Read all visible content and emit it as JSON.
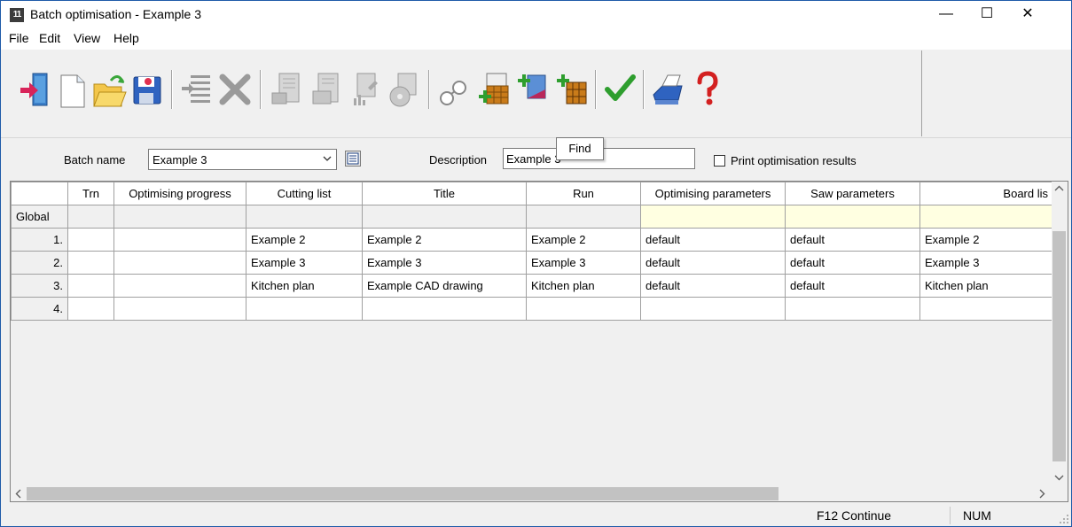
{
  "window": {
    "title": "Batch optimisation - Example 3",
    "app_icon": "11",
    "minimize": "—",
    "maximize": "☐",
    "close": "✕"
  },
  "menu": [
    "File",
    "Edit",
    "View",
    "Help"
  ],
  "toolbar": {
    "tooltip": "Find",
    "buttons": [
      "exit-icon",
      "new-icon",
      "open-icon",
      "save-icon",
      "indent-icon",
      "delete-icon",
      "preview-icon",
      "report-icon",
      "chart-report-icon",
      "saw-report-icon",
      "find-icon",
      "add-list-icon",
      "add-colour-icon",
      "add-board-icon",
      "check-icon",
      "print-icon",
      "help-icon"
    ]
  },
  "fields": {
    "batch_name_label": "Batch name",
    "batch_name_value": "Example 3",
    "description_label": "Description",
    "description_value": "Example 3",
    "print_results_label": "Print optimisation results",
    "print_results_checked": false
  },
  "grid": {
    "columns": [
      "",
      "Trn",
      "Optimising progress",
      "Cutting list",
      "Title",
      "Run",
      "Optimising parameters",
      "Saw parameters",
      "Board lis"
    ],
    "global_label": "Global",
    "rows": [
      {
        "num": "1.",
        "trn": "",
        "progress": "",
        "cutting_list": "Example 2",
        "title": "Example 2",
        "run": "Example 2",
        "opt_params": "default",
        "saw_params": "default",
        "board_list": "Example 2"
      },
      {
        "num": "2.",
        "trn": "",
        "progress": "",
        "cutting_list": "Example 3",
        "title": "Example 3",
        "run": "Example 3",
        "opt_params": "default",
        "saw_params": "default",
        "board_list": "Example 3"
      },
      {
        "num": "3.",
        "trn": "",
        "progress": "",
        "cutting_list": "Kitchen plan",
        "title": "Example CAD drawing",
        "run": "Kitchen plan",
        "opt_params": "default",
        "saw_params": "default",
        "board_list": "Kitchen plan"
      },
      {
        "num": "4.",
        "trn": "",
        "progress": "",
        "cutting_list": "",
        "title": "",
        "run": "",
        "opt_params": "",
        "saw_params": "",
        "board_list": ""
      }
    ]
  },
  "status": {
    "continue": "F12 Continue",
    "num": "NUM"
  },
  "colors": {
    "window_border": "#1e5aa8",
    "global_highlight": "#ffffe1",
    "check_green": "#2e9e2e",
    "help_red": "#d32020"
  }
}
